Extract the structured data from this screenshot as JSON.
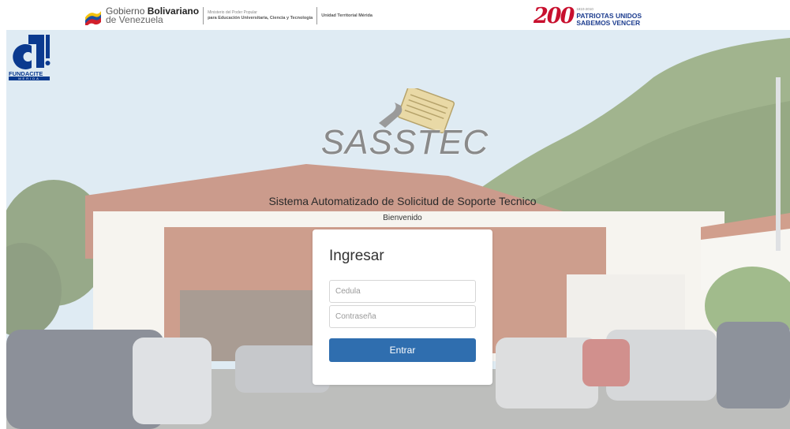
{
  "banner": {
    "gov_line1_light": "Gobierno ",
    "gov_line1_bold": "Bolivariano",
    "gov_line2": "de Venezuela",
    "ministry_line1": "Ministerio del Poder Popular",
    "ministry_line2": "para Educación Universitaria, Ciencia y Tecnología",
    "territorial_unit": "Unidad Territorial Mérida",
    "anniversary_number": "200",
    "anniversary_years": "1810-2010",
    "anniversary_line1": "PATRIOTAS UNIDOS",
    "anniversary_line2": "SABEMOS VENCER"
  },
  "fundacite": {
    "name": "FUNDACITE",
    "sub": "MERIDA"
  },
  "app": {
    "logo_text": "SASSTEC",
    "system_name": "Sistema Automatizado de Solicitud de Soporte Tecnico",
    "welcome": "Bienvenido"
  },
  "login": {
    "title": "Ingresar",
    "cedula_placeholder": "Cedula",
    "cedula_value": "",
    "password_placeholder": "Contraseña",
    "password_value": "",
    "submit_label": "Entrar",
    "submit_color": "#2f6eaf"
  },
  "colors": {
    "brand_blue": "#0b3a8f",
    "anniversary_red": "#c8102e"
  },
  "icons": {
    "gov_flag": "venezuela-flag-icon",
    "sasstec": "document-wrench-icon",
    "fundacite": "fundacite-logo-icon"
  }
}
